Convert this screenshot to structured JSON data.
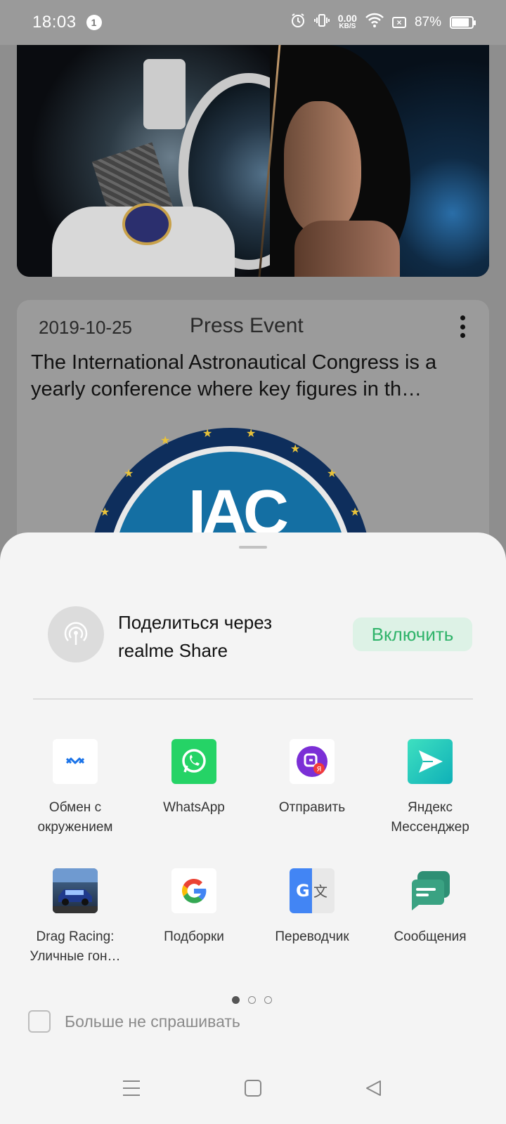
{
  "status_bar": {
    "time": "18:03",
    "notification_count": "1",
    "speed_value": "0.00",
    "speed_unit": "KB/S",
    "battery": "87%",
    "battery_level": 0.87
  },
  "feed": {
    "card": {
      "date": "2019-10-25",
      "type": "Press Event",
      "text": "The International Astronautical Congress is a yearly conference where key figures in th…",
      "logo_text": "IAC"
    }
  },
  "share_sheet": {
    "realme_share": {
      "title": "Поделиться через realme Share",
      "enable_label": "Включить"
    },
    "apps": [
      {
        "label": "Обмен с окружением",
        "icon": "nearby-share-icon"
      },
      {
        "label": "WhatsApp",
        "icon": "whatsapp-icon"
      },
      {
        "label": "Отправить",
        "icon": "yandex-send-icon"
      },
      {
        "label": "Яндекс Мессенджер",
        "icon": "yandex-messenger-icon"
      },
      {
        "label": "Drag Racing: Уличные гон…",
        "icon": "drag-racing-icon"
      },
      {
        "label": "Подборки",
        "icon": "google-icon"
      },
      {
        "label": "Переводчик",
        "icon": "google-translate-icon"
      },
      {
        "label": "Сообщения",
        "icon": "messages-icon"
      }
    ],
    "pager": {
      "pages": 3,
      "current": 1
    },
    "dont_ask_label": "Больше не спрашивать"
  },
  "colors": {
    "accent_green": "#2fb36a",
    "whatsapp": "#25d366",
    "messages": "#3aa282"
  }
}
